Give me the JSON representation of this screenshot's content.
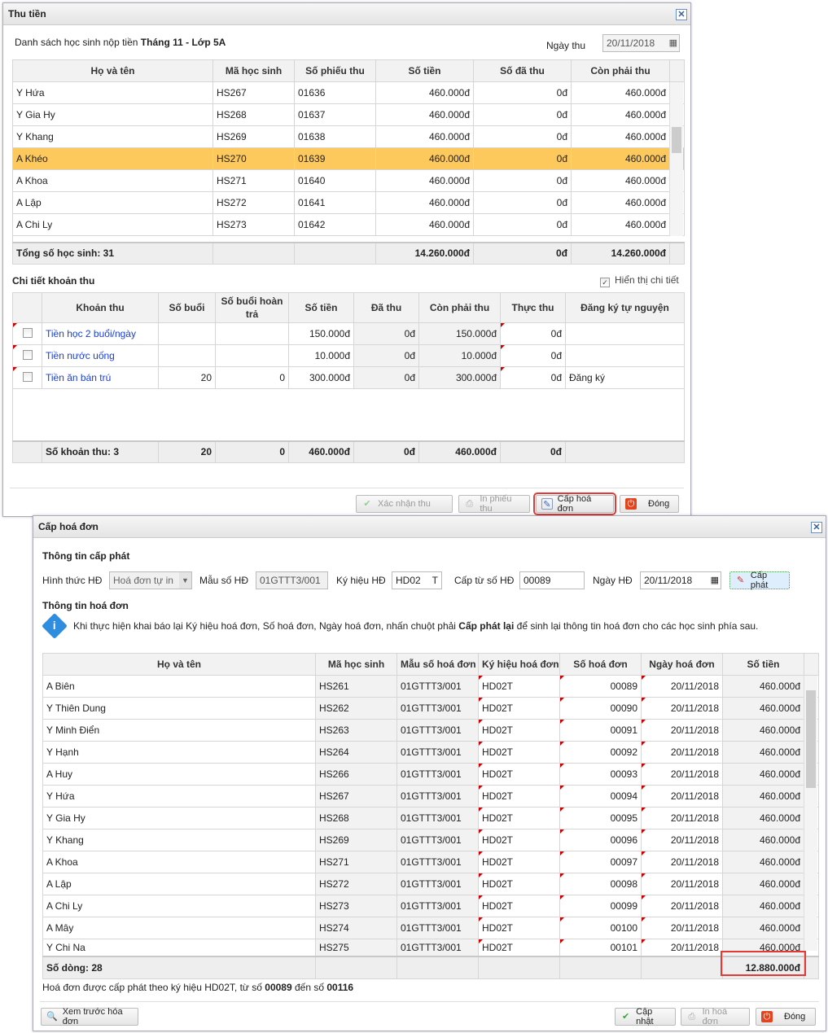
{
  "dlg1": {
    "title": "Thu tiền",
    "list_prefix": "Danh sách học sinh nộp tiền ",
    "list_bold": "Tháng 11 - Lớp 5A",
    "date_label": "Ngày thu",
    "date_value": "20/11/2018",
    "headers": [
      "Họ và tên",
      "Mã học sinh",
      "Số phiếu thu",
      "Số tiền",
      "Số đã thu",
      "Còn phải thu"
    ],
    "rows": [
      [
        "Y Hứa",
        "HS267",
        "01636",
        "460.000đ",
        "0đ",
        "460.000đ"
      ],
      [
        "Y Gia Hy",
        "HS268",
        "01637",
        "460.000đ",
        "0đ",
        "460.000đ"
      ],
      [
        "Y Khang",
        "HS269",
        "01638",
        "460.000đ",
        "0đ",
        "460.000đ"
      ],
      [
        "A Khéo",
        "HS270",
        "01639",
        "460.000đ",
        "0đ",
        "460.000đ"
      ],
      [
        "A Khoa",
        "HS271",
        "01640",
        "460.000đ",
        "0đ",
        "460.000đ"
      ],
      [
        "A Lập",
        "HS272",
        "01641",
        "460.000đ",
        "0đ",
        "460.000đ"
      ],
      [
        "A Chi Ly",
        "HS273",
        "01642",
        "460.000đ",
        "0đ",
        "460.000đ"
      ]
    ],
    "footer": [
      "Tổng số học sinh: 31",
      "",
      "",
      "14.260.000đ",
      "0đ",
      "14.260.000đ"
    ],
    "detail_title": "Chi tiết khoản thu",
    "show_detail": "Hiển thị chi tiết",
    "d_headers": [
      "",
      "Khoản thu",
      "Số buổi",
      "Số buổi hoàn trả",
      "Số tiền",
      "Đã thu",
      "Còn phải thu",
      "Thực thu",
      "Đăng ký tự nguyện"
    ],
    "d_rows": [
      [
        "Tiền học 2 buổi/ngày",
        "",
        "",
        "150.000đ",
        "0đ",
        "150.000đ",
        "0đ",
        ""
      ],
      [
        "Tiền nước uống",
        "",
        "",
        "10.000đ",
        "0đ",
        "10.000đ",
        "0đ",
        ""
      ],
      [
        "Tiền ăn bán trú",
        "20",
        "0",
        "300.000đ",
        "0đ",
        "300.000đ",
        "0đ",
        "Đăng ký"
      ]
    ],
    "d_footer": [
      "Số khoản thu: 3",
      "20",
      "0",
      "460.000đ",
      "0đ",
      "460.000đ",
      "0đ",
      ""
    ],
    "buttons": {
      "confirm": "Xác nhận thu",
      "print": "In phiếu thu",
      "invoice": "Cấp hoá đơn",
      "close": "Đóng"
    }
  },
  "dlg2": {
    "title": "Cấp hoá đơn",
    "issue_title": "Thông tin cấp phát",
    "form_label": "Hình thức HĐ",
    "form_value": "Hoá đơn tự in",
    "template_label": "Mẫu số HĐ",
    "template_value": "01GTTT3/001",
    "symbol_label": "Ký hiệu HĐ",
    "symbol_value": "HD02",
    "symbol_suffix": "T",
    "from_label": "Cấp từ số HĐ",
    "from_value": "00089",
    "date_label": "Ngày HĐ",
    "date_value": "20/11/2018",
    "issue_btn": "Cấp phát",
    "info_title": "Thông tin hoá đơn",
    "info_a": "Khi thực hiện khai báo lại Ký hiệu hoá đơn, Số hoá đơn, Ngày hoá đơn, nhấn chuột phải ",
    "info_b": "Cấp phát lại",
    "info_c": " để sinh lại thông tin hoá đơn cho các học sinh phía sau.",
    "headers": [
      "Họ và tên",
      "Mã học sinh",
      "Mẫu số hoá đơn",
      "Ký hiệu hoá đơn",
      "Số hoá đơn",
      "Ngày hoá đơn",
      "Số tiền"
    ],
    "rows": [
      [
        "A Biên",
        "HS261",
        "00089"
      ],
      [
        "Y Thiên Dung",
        "HS262",
        "00090"
      ],
      [
        "Y Minh Điển",
        "HS263",
        "00091"
      ],
      [
        "Y Hạnh",
        "HS264",
        "00092"
      ],
      [
        "A Huy",
        "HS266",
        "00093"
      ],
      [
        "Y Hứa",
        "HS267",
        "00094"
      ],
      [
        "Y Gia Hy",
        "HS268",
        "00095"
      ],
      [
        "Y Khang",
        "HS269",
        "00096"
      ],
      [
        "A Khoa",
        "HS271",
        "00097"
      ],
      [
        "A Lập",
        "HS272",
        "00098"
      ],
      [
        "A Chi Ly",
        "HS273",
        "00099"
      ],
      [
        "A Mây",
        "HS274",
        "00100"
      ],
      [
        "Y Chi Na",
        "HS275",
        "00101"
      ]
    ],
    "row_template": "01GTTT3/001",
    "row_symbol": "HD02T",
    "row_date": "20/11/2018",
    "row_amount": "460.000đ",
    "footer_label": "Số dòng: 28",
    "footer_total": "12.880.000đ",
    "summary_a": "Hoá đơn được cấp phát theo ký hiệu HD02T, từ số ",
    "summary_from": "00089",
    "summary_mid": " đến số ",
    "summary_to": "00116",
    "buttons": {
      "preview": "Xem trước hóa đơn",
      "update": "Cập nhật",
      "print": "In hoá đơn",
      "close": "Đóng"
    }
  }
}
